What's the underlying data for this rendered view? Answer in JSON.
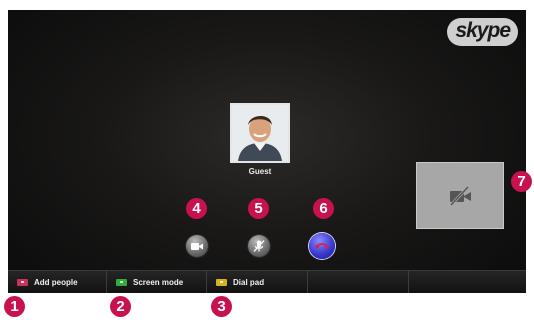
{
  "brand": {
    "logo_text": "skype"
  },
  "contact": {
    "name": "Guest"
  },
  "call_controls": {
    "video": {
      "icon": "video-camera-icon"
    },
    "mute": {
      "icon": "microphone-muted-icon"
    },
    "end": {
      "icon": "hang-up-icon",
      "color": "#3b3bd0"
    }
  },
  "self_view": {
    "icon": "video-off-icon"
  },
  "bottom_bar": {
    "items": [
      {
        "label": "Add people",
        "key_color": "#c8315a"
      },
      {
        "label": "Screen mode",
        "key_color": "#2fae3a"
      },
      {
        "label": "Dial pad",
        "key_color": "#d6b21c"
      },
      {
        "label": ""
      },
      {
        "label": ""
      }
    ]
  },
  "callouts": [
    "1",
    "2",
    "3",
    "4",
    "5",
    "6",
    "7"
  ],
  "accent_color": "#c8124f"
}
